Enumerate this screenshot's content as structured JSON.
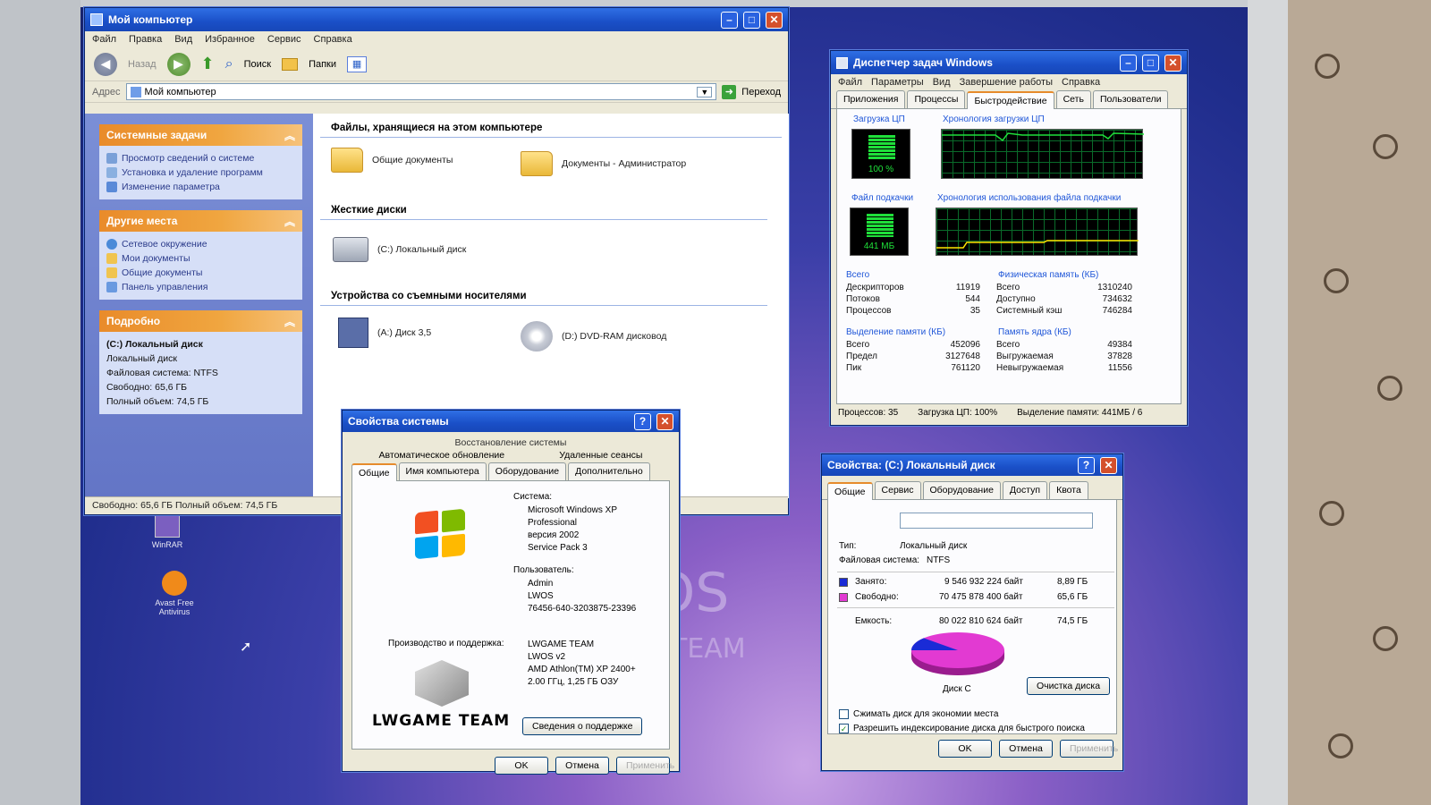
{
  "explorer": {
    "title": "Мой компьютер",
    "menu": [
      "Файл",
      "Правка",
      "Вид",
      "Избранное",
      "Сервис",
      "Справка"
    ],
    "toolbar": {
      "back": "Назад",
      "search": "Поиск",
      "folders": "Папки"
    },
    "address_label": "Адрес",
    "address_value": "Мой компьютер",
    "go_label": "Переход",
    "system_tasks": {
      "header": "Системные задачи",
      "items": [
        "Просмотр сведений о системе",
        "Установка и удаление программ",
        "Изменение параметра"
      ]
    },
    "other_places": {
      "header": "Другие места",
      "items": [
        "Сетевое окружение",
        "Мои документы",
        "Общие документы",
        "Панель управления"
      ]
    },
    "details": {
      "header": "Подробно",
      "name": "(C:) Локальный диск",
      "type": "Локальный диск",
      "fs": "Файловая система: NTFS",
      "free": "Свободно: 65,6 ГБ",
      "total": "Полный объем: 74,5 ГБ"
    },
    "sections": {
      "files": "Файлы, хранящиеся на этом компьютере",
      "hdd": "Жесткие диски",
      "removable": "Устройства со съемными носителями"
    },
    "items": {
      "shared_docs": "Общие документы",
      "admin_docs": "Документы - Администратор",
      "c_drive": "(C:) Локальный диск",
      "a_drive": "(A:) Диск 3,5",
      "d_drive": "(D:) DVD-RAM дисковод"
    },
    "status": "Свободно: 65,6 ГБ Полный объем: 74,5 ГБ"
  },
  "taskmgr": {
    "title": "Диспетчер задач Windows",
    "menu": [
      "Файл",
      "Параметры",
      "Вид",
      "Завершение работы",
      "Справка"
    ],
    "tabs": [
      "Приложения",
      "Процессы",
      "Быстродействие",
      "Сеть",
      "Пользователи"
    ],
    "cpu_label": "Загрузка ЦП",
    "cpu_value": "100 %",
    "cpu_history_label": "Хронология загрузки ЦП",
    "pf_label": "Файл подкачки",
    "pf_value": "441 МБ",
    "pf_history_label": "Хронология использования файла подкачки",
    "totals": {
      "header": "Всего",
      "rows": [
        [
          "Дескрипторов",
          "11919"
        ],
        [
          "Потоков",
          "544"
        ],
        [
          "Процессов",
          "35"
        ]
      ]
    },
    "physmem": {
      "header": "Физическая память (КБ)",
      "rows": [
        [
          "Всего",
          "1310240"
        ],
        [
          "Доступно",
          "734632"
        ],
        [
          "Системный кэш",
          "746284"
        ]
      ]
    },
    "commit": {
      "header": "Выделение памяти (КБ)",
      "rows": [
        [
          "Всего",
          "452096"
        ],
        [
          "Предел",
          "3127648"
        ],
        [
          "Пик",
          "761120"
        ]
      ]
    },
    "kernel": {
      "header": "Память ядра (КБ)",
      "rows": [
        [
          "Всего",
          "49384"
        ],
        [
          "Выгружаемая",
          "37828"
        ],
        [
          "Невыгружаемая",
          "11556"
        ]
      ]
    },
    "status": [
      "Процессов: 35",
      "Загрузка ЦП: 100%",
      "Выделение памяти: 441МБ / 6"
    ]
  },
  "sysprops": {
    "title": "Свойства системы",
    "tabs_row1": "Восстановление системы",
    "tabs_row2": [
      "Автоматическое обновление",
      "Удаленные сеансы"
    ],
    "tabs_row3": [
      "Общие",
      "Имя компьютера",
      "Оборудование",
      "Дополнительно"
    ],
    "system_label": "Система:",
    "system_lines": [
      "Microsoft Windows XP",
      "Professional",
      "версия 2002",
      "Service Pack 3"
    ],
    "user_label": "Пользователь:",
    "user_lines": [
      "Admin",
      "LWOS",
      "76456-640-3203875-23396"
    ],
    "support_label": "Производство и поддержка:",
    "support_lines": [
      "LWGAME TEAM",
      "LWOS v2",
      "AMD Athlon(TM) XP 2400+",
      "2.00 ГГц, 1,25 ГБ ОЗУ"
    ],
    "brand": "LWGAME TEAM",
    "support_button": "Сведения о поддержке",
    "ok": "OK",
    "cancel": "Отмена",
    "apply": "Применить"
  },
  "diskprops": {
    "title": "Свойства: (C:) Локальный диск",
    "tabs": [
      "Общие",
      "Сервис",
      "Оборудование",
      "Доступ",
      "Квота"
    ],
    "type_label": "Тип:",
    "type_value": "Локальный диск",
    "fs_label": "Файловая система:",
    "fs_value": "NTFS",
    "used_label": "Занято:",
    "used_bytes": "9 546 932 224 байт",
    "used_gb": "8,89 ГБ",
    "free_label": "Свободно:",
    "free_bytes": "70 475 878 400 байт",
    "free_gb": "65,6 ГБ",
    "cap_label": "Емкость:",
    "cap_bytes": "80 022 810 624 байт",
    "cap_gb": "74,5 ГБ",
    "disk_caption": "Диск C",
    "cleanup_button": "Очистка диска",
    "compress_label": "Сжимать диск для экономии места",
    "index_label": "Разрешить индексирование диска для быстрого поиска",
    "ok": "OK",
    "cancel": "Отмена",
    "apply": "Применить",
    "used_fraction": 0.119,
    "colors": {
      "used": "#1a2bd6",
      "free": "#e23ad2"
    }
  },
  "desktop": {
    "icon1": "WinRAR",
    "icon2": "Avast Free Antivirus",
    "watermark1": "OS",
    "watermark2": "TEAM"
  }
}
